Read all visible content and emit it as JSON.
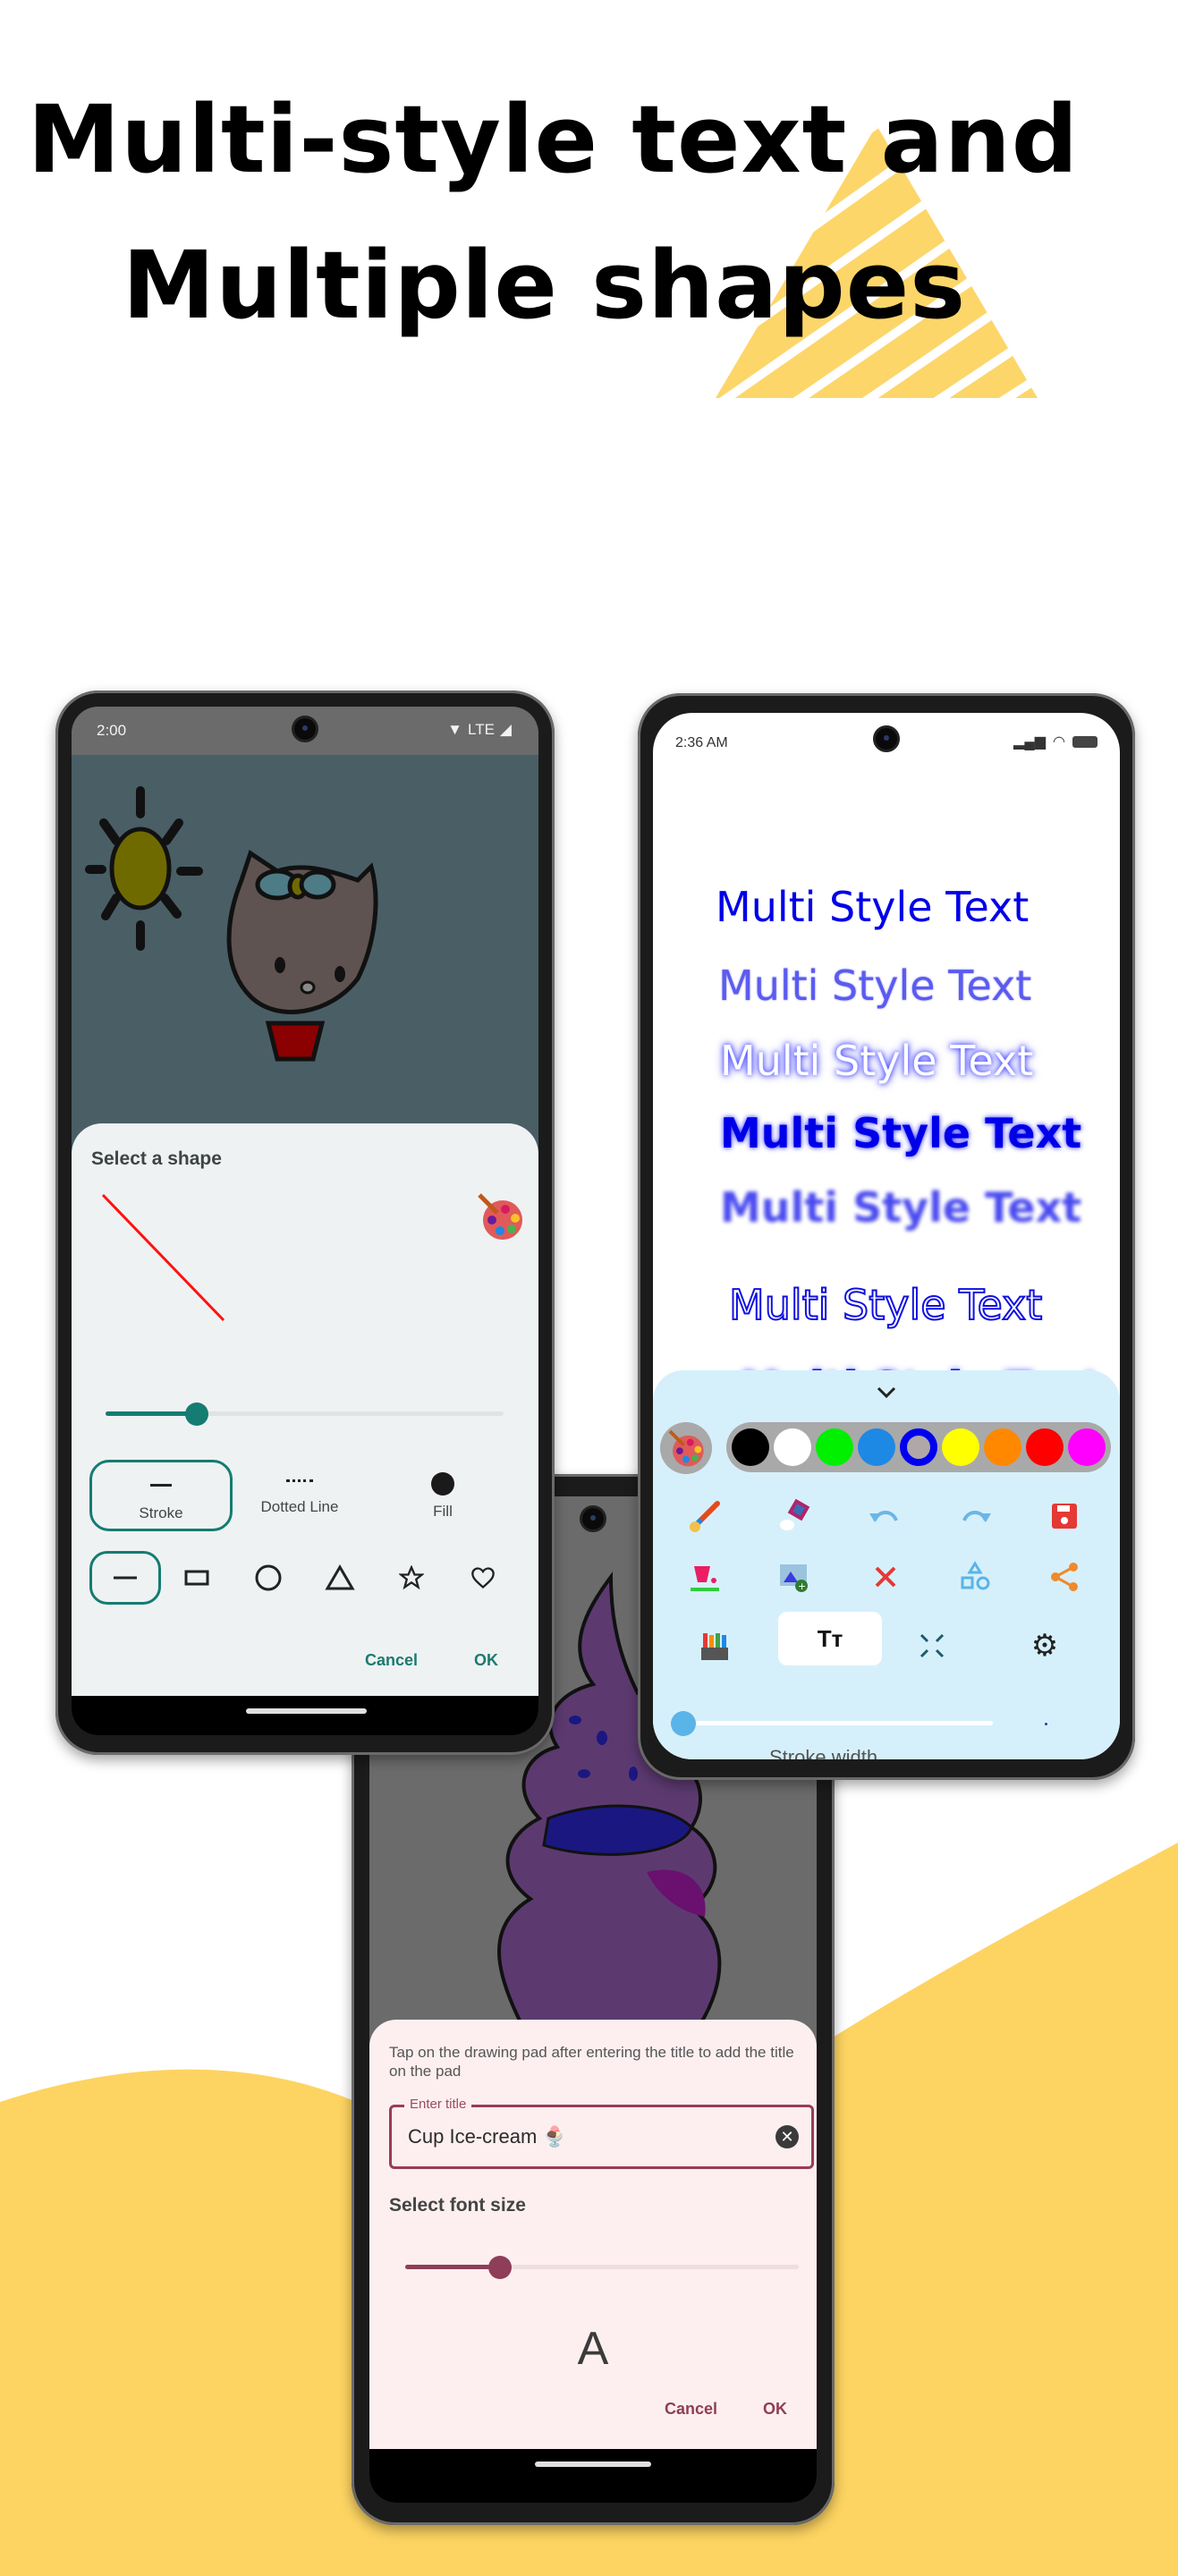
{
  "headline": {
    "line1": "Multi-style text and",
    "line2": "Multiple shapes"
  },
  "colors": {
    "accent_yellow": "#FDD462",
    "teal": "#147C72",
    "rose": "#8E3E58",
    "text_blue": "#0000E8",
    "panel_blue": "#D6F0FB"
  },
  "phone_left": {
    "status": {
      "time": "2:00",
      "network": "LTE",
      "icons": [
        "wifi-icon",
        "lte-label",
        "signal-icon"
      ]
    },
    "canvas_drawing": "hello-kitty-and-sun",
    "dialog": {
      "title": "Select a shape",
      "preview_shape": "line",
      "palette_icon": "palette-icon",
      "stroke_width_fraction": 0.23,
      "styles": [
        {
          "label": "Stroke",
          "icon": "solid-line-icon",
          "selected": true
        },
        {
          "label": "Dotted Line",
          "icon": "dotted-line-icon",
          "selected": false
        },
        {
          "label": "Fill",
          "icon": "filled-circle-icon",
          "selected": false
        }
      ],
      "shapes": [
        {
          "name": "line",
          "selected": true
        },
        {
          "name": "rectangle",
          "selected": false
        },
        {
          "name": "circle",
          "selected": false
        },
        {
          "name": "triangle",
          "selected": false
        },
        {
          "name": "star",
          "selected": false
        },
        {
          "name": "heart",
          "selected": false
        }
      ],
      "cancel_label": "Cancel",
      "ok_label": "OK"
    }
  },
  "phone_right": {
    "status": {
      "time": "2:36 AM",
      "icons": [
        "signal-icon",
        "wifi-icon",
        "battery-icon"
      ]
    },
    "text_samples": [
      {
        "text": "Multi Style Text",
        "style": "regular"
      },
      {
        "text": "Multi Style Text",
        "style": "soft"
      },
      {
        "text": "Multi Style Text",
        "style": "glow"
      },
      {
        "text": "Multi Style Text",
        "style": "bold-shadow"
      },
      {
        "text": "Multi Style Text",
        "style": "blur"
      },
      {
        "text": "Multi Style Text",
        "style": "outline"
      },
      {
        "text": "Multi Style Text",
        "style": "outline-glow"
      }
    ],
    "panel": {
      "collapse_icon": "chevron-down-icon",
      "palette_icon": "palette-icon",
      "swatches": [
        "#000000",
        "#FFFFFF",
        "#00F000",
        "#1E88E5",
        "#0000F0",
        "#FFFF00",
        "#FF8800",
        "#FF0000",
        "#FF00FF"
      ],
      "selected_swatch": 4,
      "tools_row1": [
        "brush-icon",
        "eraser-icon",
        "undo-icon",
        "redo-icon",
        "save-icon"
      ],
      "tools_row2": [
        "fill-bucket-icon",
        "add-image-icon",
        "clear-icon",
        "shapes-icon",
        "share-icon"
      ],
      "tools_row3": [
        "crayons-icon",
        "text-style-icon",
        "fullscreen-icon",
        "settings-icon"
      ],
      "text_tool_label": "Tт",
      "stroke_width_fraction": 0.0,
      "stroke_label": "Stroke width"
    }
  },
  "phone_center": {
    "canvas_drawing": "cupcake",
    "dialog": {
      "hint": "Tap on the drawing pad after entering the title to add the title on the pad",
      "field_label": "Enter title",
      "field_value": "Cup Ice-cream 🍨",
      "clear_icon": "clear-circle-icon",
      "font_size_label": "Select font size",
      "font_size_fraction": 0.24,
      "preview_letter": "A",
      "cancel_label": "Cancel",
      "ok_label": "OK"
    }
  }
}
